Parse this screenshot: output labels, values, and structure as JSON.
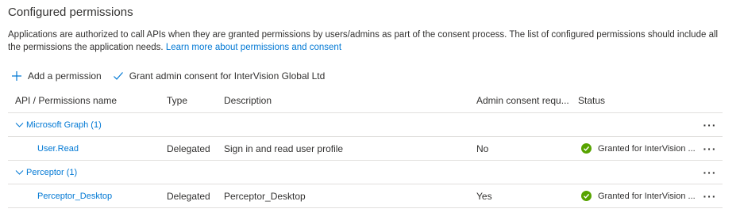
{
  "section": {
    "title": "Configured permissions",
    "description": "Applications are authorized to call APIs when they are granted permissions by users/admins as part of the consent process. The list of configured permissions should include all the permissions the application needs.",
    "learn_more": "Learn more about permissions and consent"
  },
  "toolbar": {
    "add_permission": "Add a permission",
    "grant_consent": "Grant admin consent for InterVision Global Ltd"
  },
  "table": {
    "headers": {
      "api": "API / Permissions name",
      "type": "Type",
      "description": "Description",
      "admin_consent": "Admin consent requ...",
      "status": "Status"
    },
    "groups": [
      {
        "name": "Microsoft Graph (1)",
        "more": "···",
        "permissions": [
          {
            "name": "User.Read",
            "type": "Delegated",
            "description": "Sign in and read user profile",
            "admin_consent": "No",
            "status": "Granted for InterVision ...",
            "more": "···"
          }
        ]
      },
      {
        "name": "Perceptor (1)",
        "more": "···",
        "permissions": [
          {
            "name": "Perceptor_Desktop",
            "type": "Delegated",
            "description": "Perceptor_Desktop",
            "admin_consent": "Yes",
            "status": "Granted for InterVision ...",
            "more": "···"
          }
        ]
      }
    ]
  },
  "colors": {
    "link": "#0078d4",
    "success": "#57a300",
    "border": "#e1dfdd",
    "text": "#323130"
  },
  "icons": {
    "add": "plus-icon",
    "grant": "checkmark-icon",
    "collapse": "chevron-down-icon",
    "granted": "success-check-circle-icon",
    "more": "more-ellipsis-icon"
  }
}
